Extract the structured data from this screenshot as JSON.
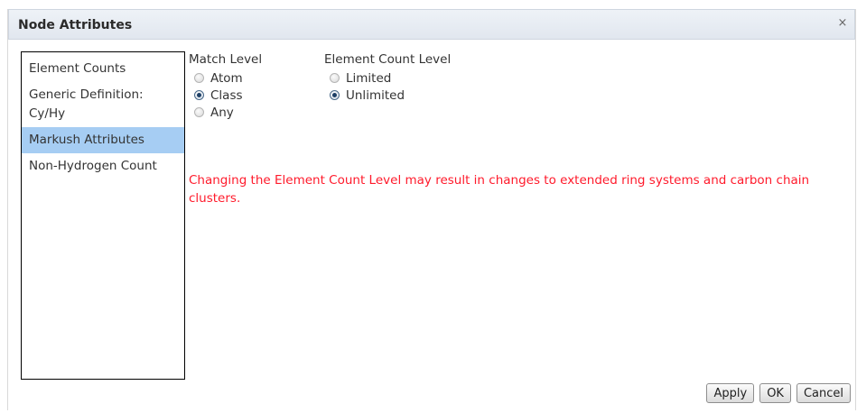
{
  "dialog": {
    "title": "Node Attributes",
    "close_glyph": "×"
  },
  "nav": {
    "items": [
      {
        "label": "Element Counts",
        "selected": false
      },
      {
        "label": "Generic Definition: Cy/Hy",
        "selected": false
      },
      {
        "label": "Markush Attributes",
        "selected": true
      },
      {
        "label": "Non-Hydrogen Count",
        "selected": false
      }
    ]
  },
  "match_level": {
    "label": "Match Level",
    "options": [
      {
        "label": "Atom",
        "checked": false
      },
      {
        "label": "Class",
        "checked": true
      },
      {
        "label": "Any",
        "checked": false
      }
    ]
  },
  "element_count_level": {
    "label": "Element Count Level",
    "options": [
      {
        "label": "Limited",
        "checked": false
      },
      {
        "label": "Unlimited",
        "checked": true
      }
    ]
  },
  "warning": {
    "text": "Changing the Element Count Level may result in changes to extended ring systems and carbon chain clusters.",
    "color": "#ff1a2b"
  },
  "buttons": {
    "apply": "Apply",
    "ok": "OK",
    "cancel": "Cancel"
  },
  "colors": {
    "selected_nav": "#a6cdf3"
  }
}
